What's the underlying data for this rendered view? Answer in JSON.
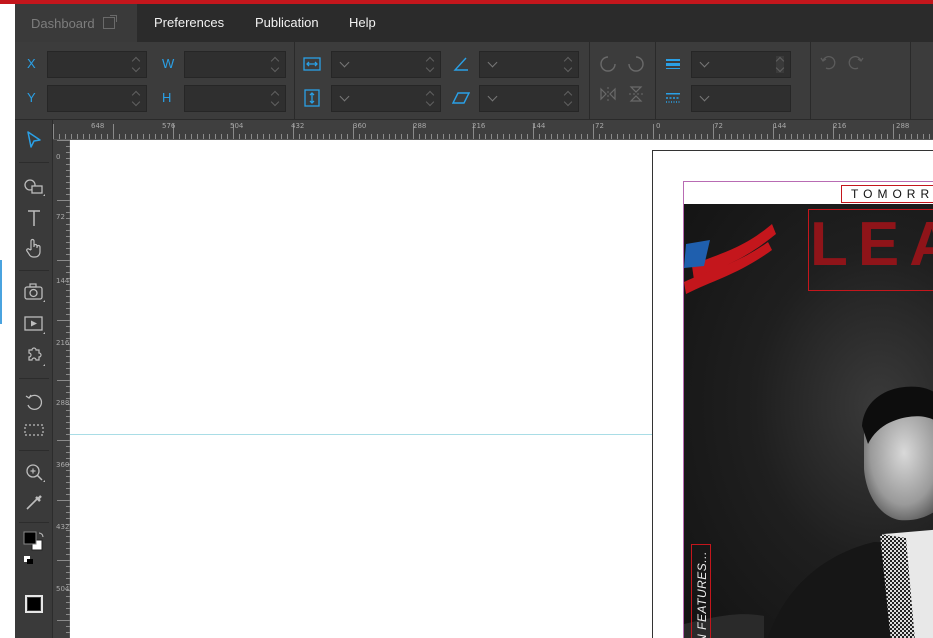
{
  "menubar": {
    "dashboard": "Dashboard",
    "preferences": "Preferences",
    "publication": "Publication",
    "help": "Help"
  },
  "toolbar": {
    "x_label": "X",
    "y_label": "Y",
    "w_label": "W",
    "h_label": "H"
  },
  "rulers": {
    "top_ticks": [
      "648",
      "576",
      "504",
      "432",
      "360",
      "288",
      "216",
      "144",
      "72",
      "0",
      "72",
      "144",
      "216",
      "288"
    ],
    "left_ticks": [
      "0",
      "72",
      "144",
      "216",
      "288",
      "360",
      "432",
      "504"
    ]
  },
  "document": {
    "masthead_top": "TOMORR",
    "masthead_title": "LEA",
    "side_features": "N FEATURES..."
  },
  "colors": {
    "accent": "#2aa0e6",
    "brand_red": "#c4161c",
    "title_red": "#8f1419",
    "guide": "#a9dde6"
  },
  "icons": [
    "external-link-icon",
    "width-icon",
    "height-icon",
    "angle-icon",
    "skew-icon",
    "rotate-ccw-icon",
    "rotate-cw-icon",
    "flip-horizontal-icon",
    "flip-vertical-icon",
    "stroke-weight-icon",
    "stroke-style-icon",
    "undo-icon",
    "redo-icon",
    "select-arrow-icon",
    "shape-icon",
    "text-icon",
    "hand-icon",
    "camera-icon",
    "video-icon",
    "widget-icon",
    "rotate-tool-icon",
    "crop-icon",
    "zoom-icon",
    "eyedropper-icon",
    "color-swatch-icon",
    "swap-colors-icon",
    "frame-icon"
  ]
}
